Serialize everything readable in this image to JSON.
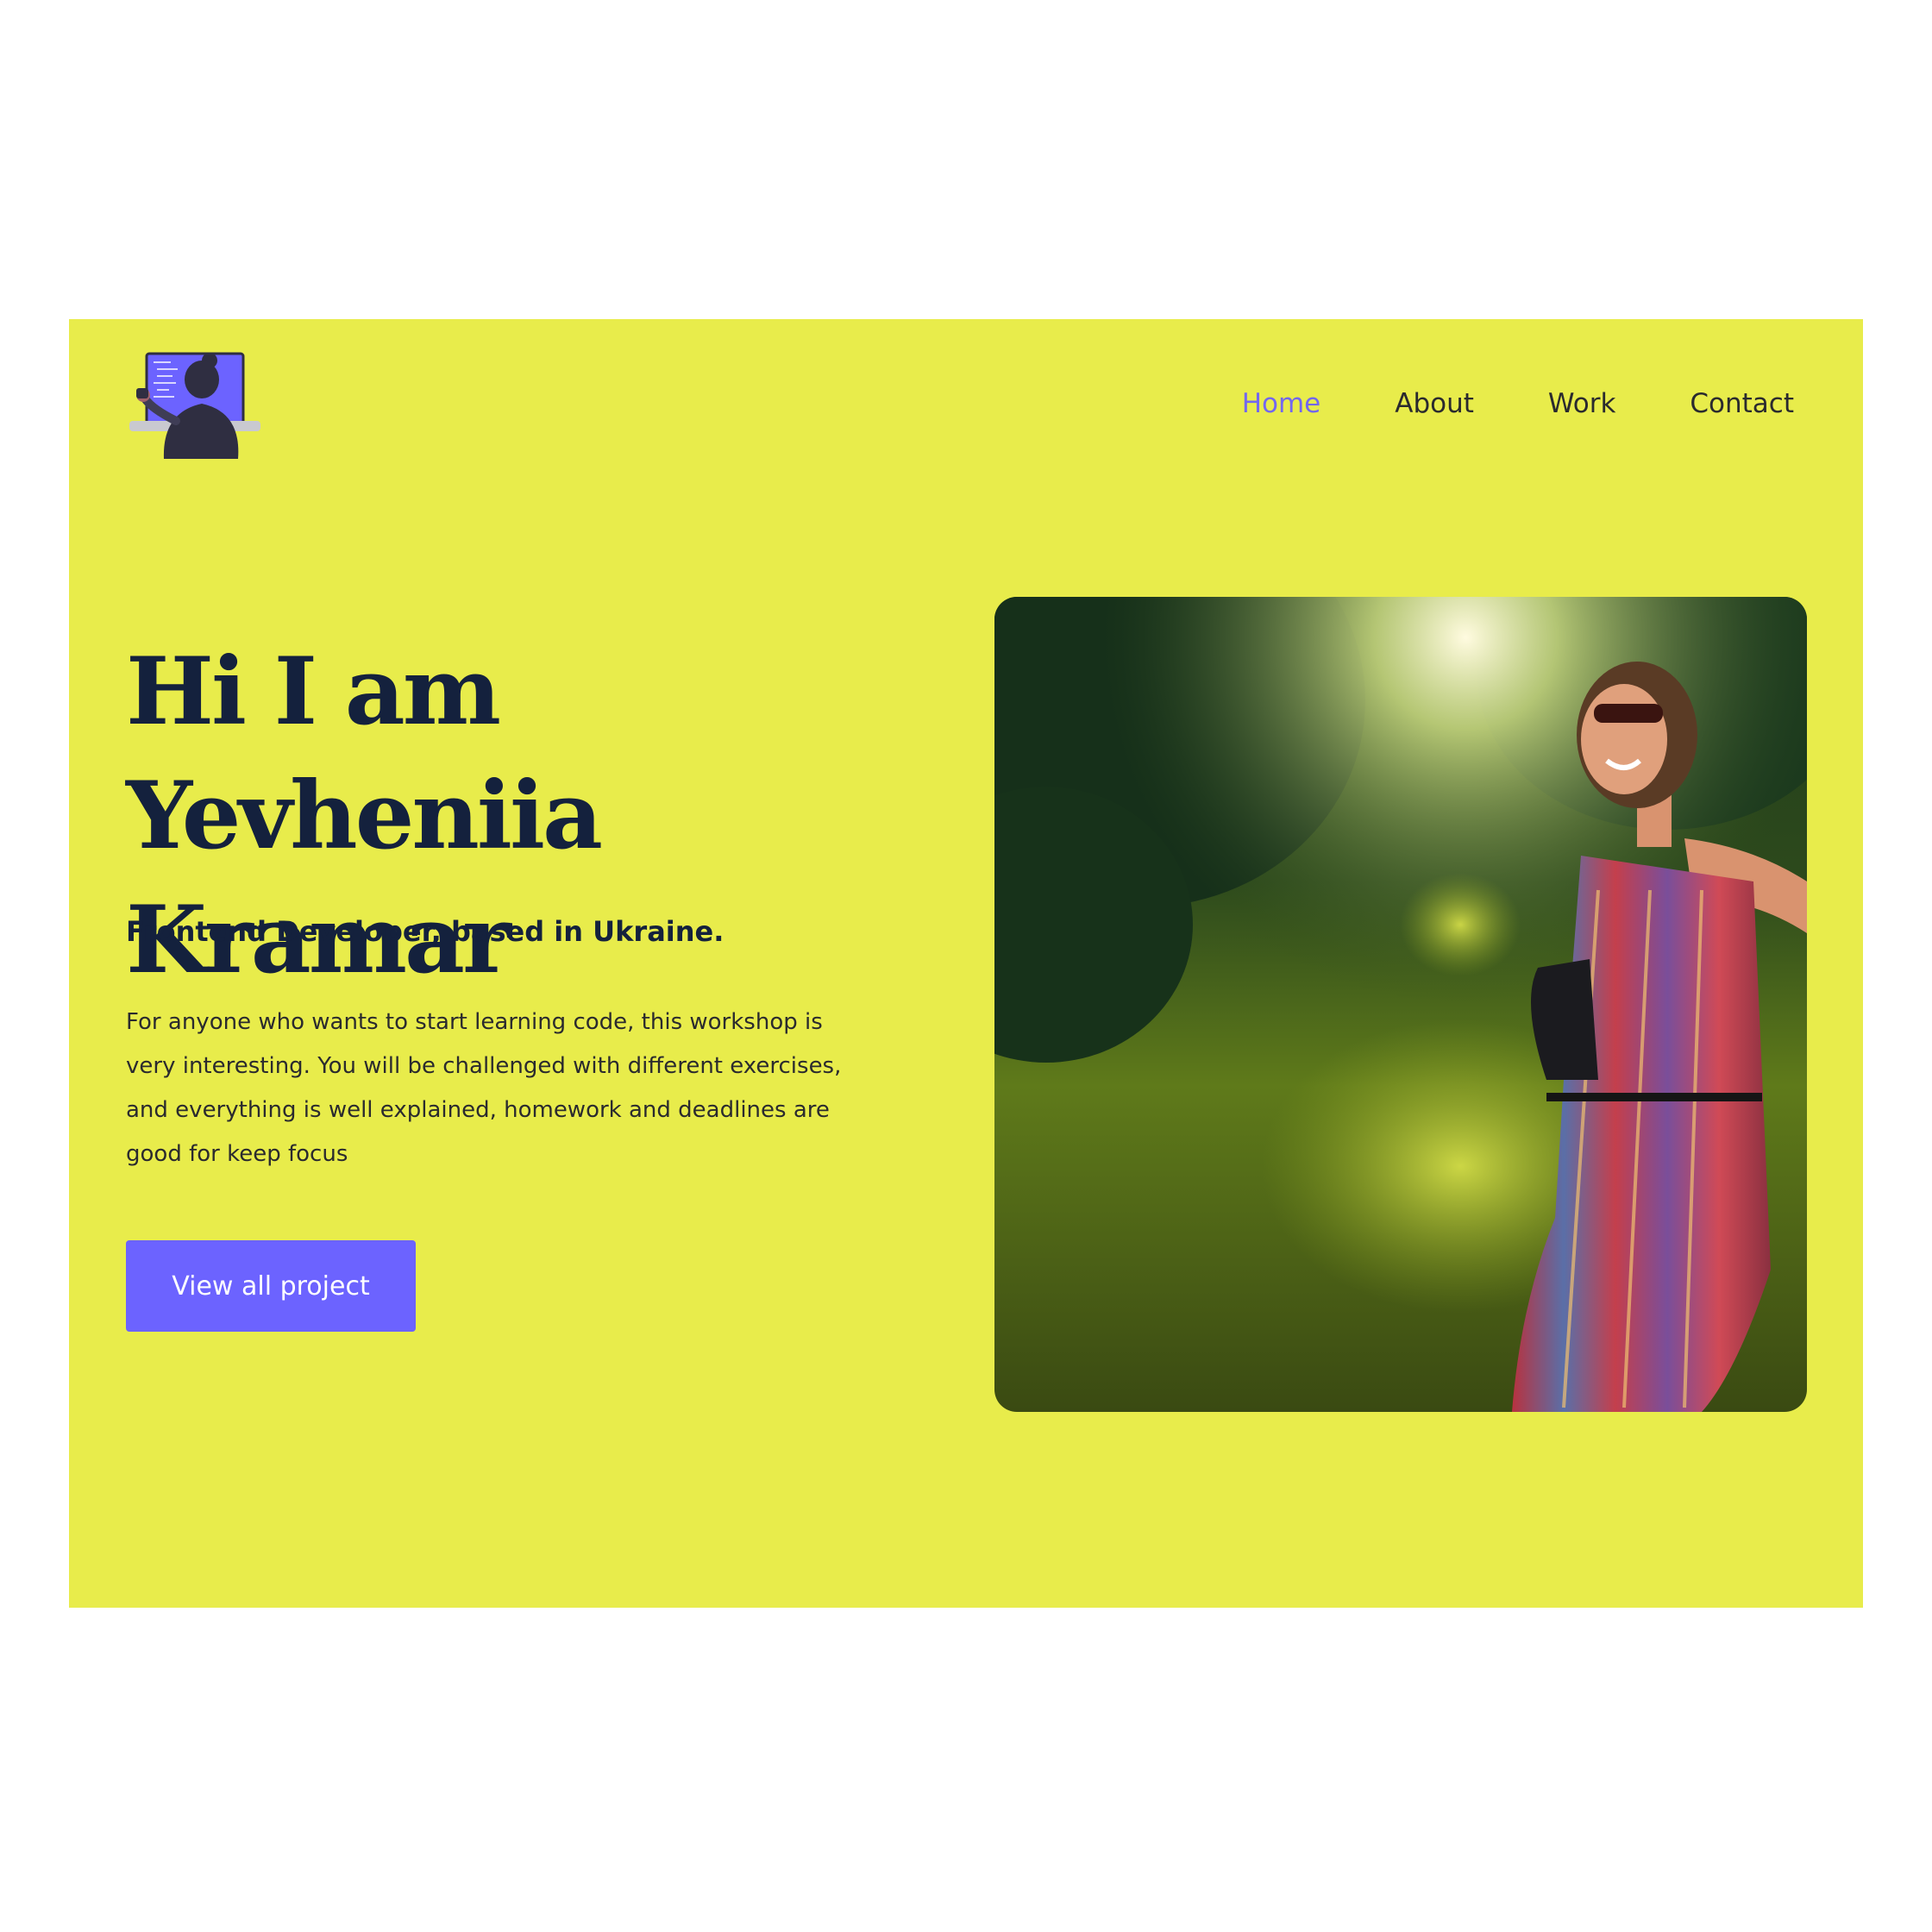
{
  "nav": {
    "items": [
      {
        "label": "Home",
        "active": true
      },
      {
        "label": "About",
        "active": false
      },
      {
        "label": "Work",
        "active": false
      },
      {
        "label": "Contact",
        "active": false
      }
    ]
  },
  "hero": {
    "title": "Hi I am Yevheniia Kramar",
    "subtitle": "Frontend Developer, based in Ukraine.",
    "description": "For anyone who wants to start learning code, this workshop is very interesting. You will be challenged  with different exercises, and everything is well explained, homework and deadlines are good for keep focus",
    "cta_label": "View all project"
  },
  "colors": {
    "background": "#e8ec4b",
    "accent": "#6c63ff",
    "heading": "#14213d",
    "nav_active": "#7367f0"
  },
  "icons": {
    "logo": "developer-at-laptop-icon"
  }
}
